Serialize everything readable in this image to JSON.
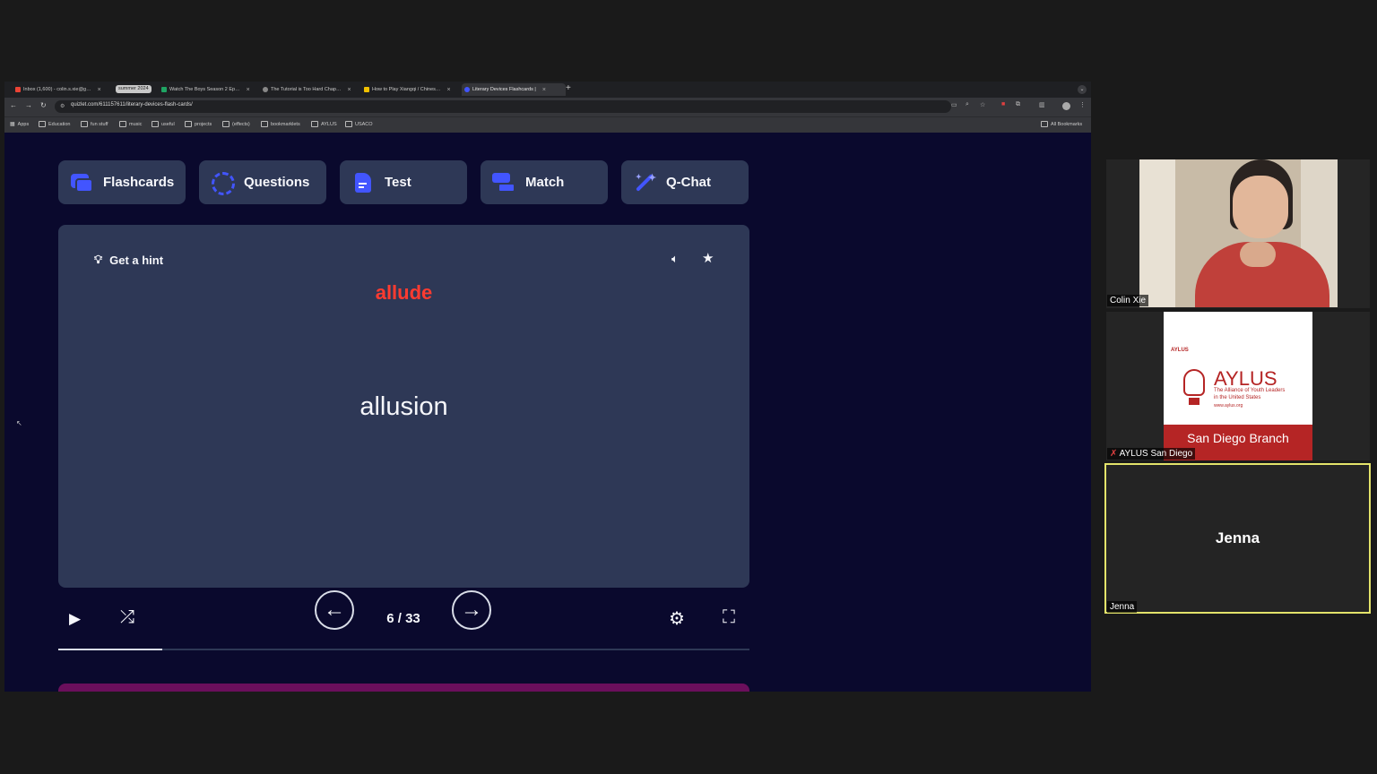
{
  "browser": {
    "tabs": [
      {
        "label": "Inbox (1,600) - colin.s.xie@g…",
        "favicon_color": "#ea4335"
      },
      {
        "label": "summer 2024",
        "favicon_color": "#c9c9c9"
      },
      {
        "label": "Watch The Boys Season 2 Ep…",
        "favicon_color": "#1fa463"
      },
      {
        "label": "The Tutorial is Too Hard Chap…",
        "favicon_color": "#888888"
      },
      {
        "label": "How to Play Xiangqi / Chines…",
        "favicon_color": "#f0c000"
      },
      {
        "label": "Literary Devices Flashcards |",
        "favicon_color": "#4255ff"
      }
    ],
    "url": "quizlet.com/611157611/literary-devices-flash-cards/",
    "bookmarks": [
      "Apps",
      "Education",
      "fun stuff",
      "music",
      "useful",
      "projects",
      "(effects)",
      "bookmarklets",
      "AYLUS",
      "USACO"
    ],
    "all_bookmarks": "All Bookmarks"
  },
  "modes": [
    {
      "label": "Flashcards",
      "icon": "flashcards-icon"
    },
    {
      "label": "Questions",
      "icon": "questions-icon"
    },
    {
      "label": "Test",
      "icon": "test-icon"
    },
    {
      "label": "Match",
      "icon": "match-icon"
    },
    {
      "label": "Q-Chat",
      "icon": "qchat-icon"
    }
  ],
  "card": {
    "hint_label": "Get a hint",
    "front_term": "allude",
    "back_term": "allusion"
  },
  "controls": {
    "counter": "6 / 33",
    "progress_fraction": 0.15
  },
  "participants": [
    {
      "name": "Colin Xie"
    },
    {
      "name": "AYLUS San Diego"
    },
    {
      "name": "Jenna",
      "display_name": "Jenna"
    }
  ],
  "aylus_card": {
    "small_logo": "AYLUS",
    "brand": "AYLUS",
    "tagline_1": "The Alliance of Youth Leaders",
    "tagline_2": "in the United States",
    "website": "www.aylus.org",
    "branch": "San Diego Branch"
  },
  "colors": {
    "accent": "#4255ff",
    "card_bg": "#2e3856",
    "page_bg": "#0a092d",
    "term_red": "#ff3b30",
    "speaker_border": "#e3e36a"
  }
}
